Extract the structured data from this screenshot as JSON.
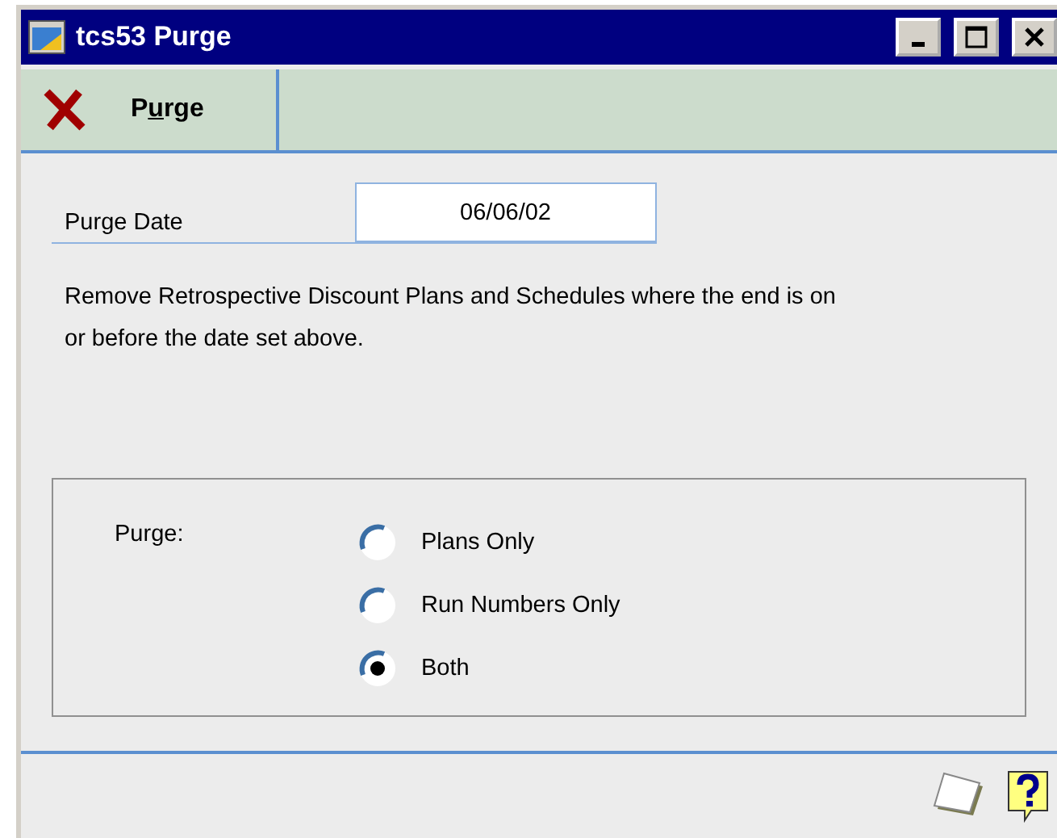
{
  "window": {
    "title": "tcs53 Purge"
  },
  "toolbar": {
    "button": {
      "label": "Purge"
    }
  },
  "purge_date": {
    "label": "Purge Date",
    "value": "06/06/02"
  },
  "description": "Remove Retrospective Discount Plans and Schedules where the end is on or before the date set above.",
  "purge_group": {
    "label": "Purge:",
    "options": [
      {
        "label": "Plans Only",
        "selected": false
      },
      {
        "label": "Run Numbers Only",
        "selected": false
      },
      {
        "label": "Both",
        "selected": true
      }
    ]
  }
}
